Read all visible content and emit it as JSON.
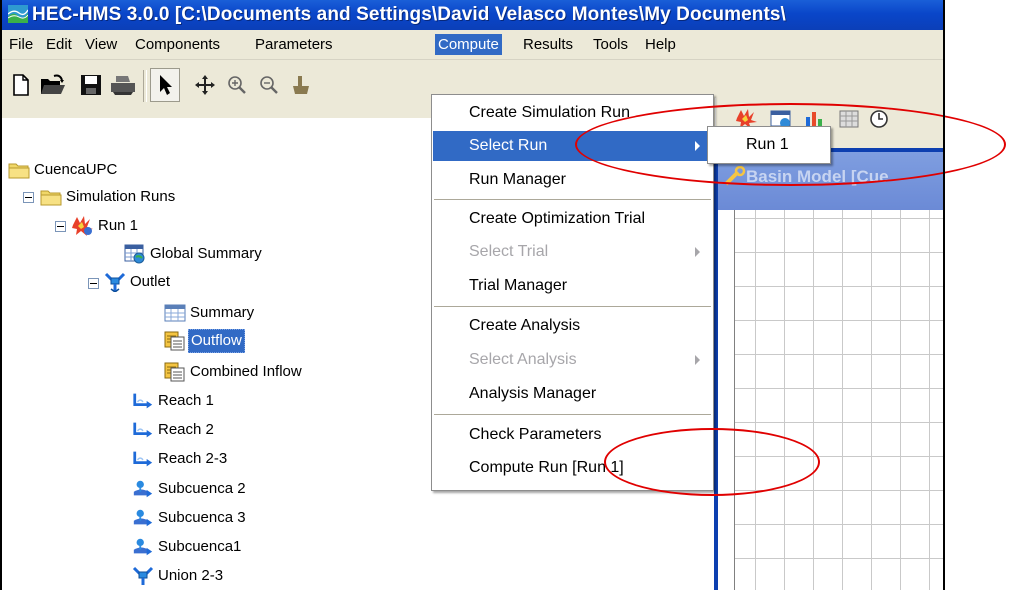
{
  "window": {
    "title": "HEC-HMS 3.0.0 [C:\\Documents and Settings\\David Velasco Montes\\My Documents\\",
    "app_icon": "hec-hms-app-icon"
  },
  "menubar": {
    "items": [
      {
        "label": "File"
      },
      {
        "label": "Edit"
      },
      {
        "label": "View"
      },
      {
        "label": "Components"
      },
      {
        "label": "Parameters"
      },
      {
        "label": "Compute"
      },
      {
        "label": "Results"
      },
      {
        "label": "Tools"
      },
      {
        "label": "Help"
      }
    ],
    "active": "Compute"
  },
  "toolbar": {
    "icons": [
      "new-file-icon",
      "open-folder-icon",
      "save-icon",
      "print-icon",
      "select-arrow-icon",
      "pan-move-icon",
      "zoom-in-icon",
      "zoom-out-icon",
      "add-element-icon"
    ]
  },
  "toolbar2": {
    "icons": [
      "compute-run-icon",
      "global-summary-icon",
      "bar-chart-icon",
      "table-icon",
      "time-series-icon"
    ]
  },
  "tree": {
    "root": "CuencaUPC",
    "simulation_runs": "Simulation Runs",
    "run": "Run 1",
    "global_summary": "Global Summary",
    "outlet": "Outlet",
    "summary": "Summary",
    "outflow": "Outflow",
    "combined_inflow": "Combined Inflow",
    "elements": [
      {
        "label": "Reach 1",
        "type": "reach-icon"
      },
      {
        "label": "Reach 2",
        "type": "reach-icon"
      },
      {
        "label": "Reach 2-3",
        "type": "reach-icon"
      },
      {
        "label": "Subcuenca 2",
        "type": "subbasin-icon"
      },
      {
        "label": "Subcuenca 3",
        "type": "subbasin-icon"
      },
      {
        "label": "Subcuenca1",
        "type": "subbasin-icon"
      },
      {
        "label": "Union 2-3",
        "type": "junction-icon"
      }
    ],
    "selected": "Outflow"
  },
  "compute_menu": {
    "items": [
      {
        "label": "Create Simulation Run",
        "enabled": true
      },
      {
        "label": "Select Run",
        "enabled": true,
        "submenu": true,
        "highlighted": true
      },
      {
        "label": "Run Manager",
        "enabled": true
      },
      {
        "label": "Create Optimization Trial",
        "enabled": true
      },
      {
        "label": "Select Trial",
        "enabled": false,
        "submenu": true
      },
      {
        "label": "Trial Manager",
        "enabled": true
      },
      {
        "label": "Create Analysis",
        "enabled": true
      },
      {
        "label": "Select Analysis",
        "enabled": false,
        "submenu": true
      },
      {
        "label": "Analysis Manager",
        "enabled": true
      },
      {
        "label": "Check Parameters",
        "enabled": true
      },
      {
        "label": "Compute Run [Run 1]",
        "enabled": true
      }
    ]
  },
  "select_run_submenu": {
    "items": [
      {
        "label": "Run 1"
      }
    ]
  },
  "basin_model": {
    "title": "Basin Model [Cue"
  },
  "colors": {
    "titlebar": "#0a46c9",
    "menu_highlight": "#316ac5",
    "annotation": "#e00000",
    "window_face": "#ece9d8"
  }
}
